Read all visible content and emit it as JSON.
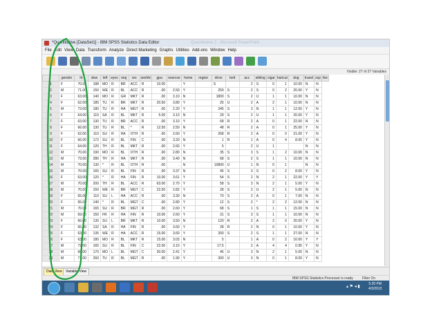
{
  "window": {
    "title": "*Quantitative [DataSet1] - IBM SPSS Statistics Data Editor",
    "background_title": "Quantitative 2 - Microsoft PowerPoint"
  },
  "menu": [
    "File",
    "Edit",
    "View",
    "Data",
    "Transform",
    "Analyze",
    "Direct Marketing",
    "Graphs",
    "Utilities",
    "Add-ons",
    "Window",
    "Help"
  ],
  "toolbar_icons": [
    "open-icon",
    "save-icon",
    "print-icon",
    "recall-dialog-icon",
    "undo-icon",
    "redo-icon",
    "goto-case-icon",
    "goto-variable-icon",
    "variables-icon",
    "find-icon",
    "insert-cases-icon",
    "insert-variable-icon",
    "split-file-icon",
    "weight-cases-icon",
    "select-cases-icon",
    "value-labels-icon",
    "use-sets-icon",
    "show-all-icon",
    "spell-icon"
  ],
  "visible_variables": "Visible: 27 of 27 Variables",
  "columns": [
    "gender",
    "ht",
    "dow",
    "left",
    "eyes",
    "maj",
    "res",
    "workfx",
    "gpa",
    "exercse",
    "home",
    "region",
    "drive",
    "belt",
    "acc",
    "sibling",
    "cigar",
    "haircut",
    "dog",
    "travel",
    "zsp",
    "fee"
  ],
  "rows": [
    [
      "1",
      "F",
      "70.00",
      "188",
      "MO",
      "R",
      "BR",
      "ACC",
      "R",
      "10.00",
      ".",
      "Y",
      "",
      "S",
      "",
      "2",
      "S",
      "0",
      "1",
      "10.00",
      "N",
      "N"
    ],
    [
      "2",
      "M",
      "71.00",
      "150",
      "WE",
      "R",
      "BL",
      "ACC",
      "R",
      ".00",
      "2.50",
      "Y",
      "",
      "259",
      "S",
      "2",
      "S",
      "0",
      "2",
      "20.00",
      "Y",
      "N"
    ],
    [
      "3",
      "F",
      "63.00",
      "140",
      "MO",
      "R",
      "GR",
      "MKT",
      "R",
      ".00",
      "3.10",
      "N",
      "",
      "1800",
      "S",
      "2",
      "U",
      "1",
      "1",
      "10.00",
      "N",
      "N"
    ],
    [
      "4",
      "F",
      "62.00",
      "185",
      "TU",
      "R",
      "BR",
      "MKT",
      "R",
      "20.50",
      "3.80",
      "Y",
      "",
      "25",
      "U",
      "2",
      "A",
      "2",
      "1",
      "10.00",
      "N",
      "N"
    ],
    [
      "5",
      "M",
      "73.00",
      "180",
      "TU",
      "R",
      "HA",
      "MGT",
      "R",
      ".00",
      "2.20",
      "Y",
      "",
      "245",
      "S",
      "3",
      "N",
      "1",
      "1",
      "12.00",
      "Y",
      "N"
    ],
    [
      "6",
      "F",
      "64.00",
      "115",
      "SA",
      "R",
      "BL",
      "MKT",
      "R",
      "5.00",
      "3.10",
      "N",
      "",
      "29",
      "S",
      "2",
      "U",
      "1",
      "1",
      "20.00",
      "Y",
      "N"
    ],
    [
      "7",
      "F",
      "63.00",
      "130",
      "TU",
      "R",
      "BR",
      "ACC",
      "R",
      ".00",
      "3.10",
      "Y",
      "",
      "68",
      "R",
      "2",
      "A",
      "0",
      "1",
      "22.00",
      "N",
      "N"
    ],
    [
      "8",
      "F",
      "66.00",
      "130",
      "TU",
      "R",
      "BL",
      "*",
      "R",
      "12.50",
      "2.50",
      "N",
      "",
      "48",
      "R",
      "2",
      "A",
      "0",
      "1",
      "25.00",
      "Y",
      "N"
    ],
    [
      "9",
      "F",
      "62.00",
      "110",
      "SU",
      "R",
      "HA",
      "OTH",
      "R",
      ".00",
      "2.60",
      "Y",
      "",
      "268",
      "R",
      "2",
      "A",
      "0",
      "0",
      "21.00",
      "Y",
      "N"
    ],
    [
      "10",
      "F",
      "66.00",
      "172",
      "SU",
      "R",
      "BL",
      "FIN",
      "C",
      ".00",
      "3.20",
      "N",
      "",
      "1",
      "R",
      "1",
      "A",
      "0",
      "4",
      "8.00",
      "Y",
      "N"
    ],
    [
      "11",
      "F",
      "64.00",
      "120",
      "TH",
      "R",
      "BL",
      "MKT",
      "R",
      ".00",
      "2.60",
      "Y",
      "",
      "5",
      "",
      "2",
      "U",
      "1",
      "",
      "",
      "N",
      "N"
    ],
    [
      "12",
      "M",
      "70.00",
      "190",
      "MO",
      "R",
      "BL",
      "OTH",
      "R",
      ".00",
      "2.80",
      "N",
      "",
      "35",
      "S",
      "3",
      "S",
      "1",
      "2",
      "10.00",
      "N",
      "N"
    ],
    [
      "13",
      "M",
      "73.00",
      "280",
      "TH",
      "R",
      "HA",
      "MKT",
      "R",
      ".00",
      "3.40",
      "N",
      "",
      "68",
      "S",
      "2",
      "S",
      "1",
      "1",
      "10.00",
      "N",
      "N"
    ],
    [
      "14",
      "M",
      "70.00",
      "130",
      "*",
      "R",
      "BL",
      "OTH",
      "R",
      ".00",
      ".",
      "N",
      "",
      "10800",
      "U",
      "1",
      "N",
      "0",
      "1",
      "",
      "N",
      "N"
    ],
    [
      "15",
      "M",
      "70.00",
      "165",
      "SU",
      "R",
      "BL",
      "FIN",
      "R",
      ".00",
      "3.37",
      "N",
      "",
      "45",
      "S",
      "3",
      "S",
      "0",
      "2",
      "8.00",
      "Y",
      "N"
    ],
    [
      "16",
      "F",
      "63.00",
      "120",
      "*",
      "R",
      "HA",
      "FIN",
      "R",
      "10.00",
      "3.61",
      "Y",
      "",
      "54",
      "S",
      "2",
      "N",
      "2",
      "1",
      "22.00",
      "Y",
      "Y"
    ],
    [
      "17",
      "M",
      "70.00",
      "200",
      "TH",
      "R",
      "BL",
      "ACC",
      "R",
      "63.00",
      "2.70",
      "Y",
      "",
      "58",
      "S",
      "3",
      "N",
      "2",
      "1",
      "5.00",
      "Y",
      "N"
    ],
    [
      "18",
      "M",
      "70.00",
      "150",
      "WE",
      "R",
      "BR",
      "MGT",
      "C",
      "22.50",
      "2.82",
      "Y",
      "",
      "28",
      "S",
      "2",
      "U",
      "2",
      "1",
      "5.00",
      "N",
      "N"
    ],
    [
      "19",
      "F",
      "65.00",
      "110",
      "SU",
      "L",
      "HA",
      "ACC",
      "R",
      ".00",
      "3.30",
      "N",
      "",
      "70",
      "S",
      "2",
      "A",
      "0",
      "1",
      "7.00",
      "N",
      "N"
    ],
    [
      "20",
      "F",
      "65.00",
      "140",
      "*",
      "R",
      "BL",
      "MGT",
      "C",
      ".00",
      "2.80",
      "Y",
      "",
      "12",
      "S",
      "2",
      "*",
      "2",
      "2",
      "12.00",
      "N",
      "N"
    ],
    [
      "21",
      "M",
      "70.00",
      "165",
      "SU",
      "R",
      "BR",
      "MGT",
      "R",
      ".00",
      "2.60",
      "Y",
      "",
      "68",
      "S",
      "1",
      "S",
      "1",
      "1",
      "15.00",
      "N",
      "N"
    ],
    [
      "22",
      "M",
      "69.00",
      "150",
      "FR",
      "R",
      "HA",
      "FIN",
      "R",
      "10.00",
      "2.60",
      "Y",
      "",
      "31",
      "S",
      "3",
      "S",
      "1",
      "1",
      "10.00",
      "N",
      "N"
    ],
    [
      "23",
      "F",
      "66.00",
      "130",
      "SU",
      "L",
      "BR",
      "MKT",
      "R",
      "10.00",
      "3.50",
      "N",
      "",
      "120",
      "R",
      "2",
      "A",
      "2",
      "0",
      "20.00",
      "Y",
      "N"
    ],
    [
      "24",
      "F",
      "66.00",
      "132",
      "SA",
      "R",
      "HA",
      "FIN",
      "R",
      ".00",
      "3.60",
      "Y",
      "",
      "28",
      "R",
      "2",
      "N",
      "0",
      "1",
      "10.00",
      "Y",
      "N"
    ],
    [
      "25",
      "F",
      "63.00",
      "135",
      "WE",
      "R",
      "HA",
      "ACC",
      "R",
      "15.00",
      "3.60",
      "Y",
      "",
      "300",
      "S",
      "2",
      "S",
      "1",
      "1",
      "27.00",
      "N",
      "N"
    ],
    [
      "26",
      "F",
      "63.00",
      "180",
      "MO",
      "R",
      "BL",
      "MKT",
      "R",
      "15.00",
      "3.03",
      "N",
      "",
      "5",
      "",
      "1",
      "A",
      "0",
      "2",
      "10.00",
      "Y",
      "Y"
    ],
    [
      "27",
      "M",
      "72.00",
      "165",
      "SU",
      "R",
      "BL",
      "FIN",
      "C",
      "22.00",
      "3.10",
      "Y",
      "",
      "17.5",
      "",
      "2",
      "A",
      "4",
      "4",
      "0.95",
      "Y",
      "N"
    ],
    [
      "28",
      "M",
      "66.00",
      "170",
      "MO",
      "L",
      "BL",
      "MGT",
      "C",
      "30.00",
      "2.41",
      "Y",
      "",
      "45",
      "U",
      "3",
      "N",
      "2",
      "1",
      "5.00",
      "N",
      "N"
    ],
    [
      "29",
      "M",
      "71.00",
      "260",
      "TU",
      "R",
      "BL",
      "MGT",
      "R",
      ".00",
      "1.90",
      "Y",
      "",
      "300",
      "U",
      "3",
      "N",
      "0",
      "1",
      "8.00",
      "Y",
      "N"
    ]
  ],
  "tabs": [
    "Data View",
    "Variable View"
  ],
  "status": {
    "processor": "IBM SPSS Statistics Processor is ready",
    "filter": "Filter On"
  },
  "taskbar": {
    "clock_time": "5:20 PM",
    "clock_date": "4/3/2013"
  },
  "colors": {
    "annotation": "#1a9e3a",
    "active_tab": "#fff3b0",
    "taskbar": "#2f5d86"
  }
}
